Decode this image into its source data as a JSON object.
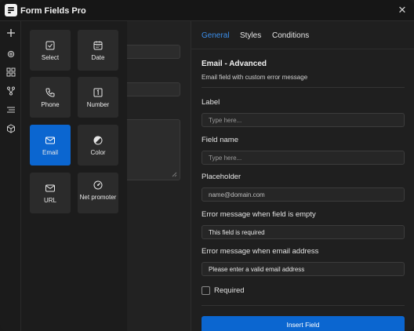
{
  "app": {
    "title": "Form Fields Pro"
  },
  "rail": {
    "icons": [
      "plus-icon",
      "gear-icon",
      "blocks-icon",
      "branch-icon",
      "align-icon",
      "cube-icon"
    ]
  },
  "picker": {
    "tiles": [
      {
        "label": "Select",
        "icon": "checkbox-icon"
      },
      {
        "label": "Date",
        "icon": "calendar-icon"
      },
      {
        "label": "Phone",
        "icon": "phone-icon"
      },
      {
        "label": "Number",
        "icon": "number-icon"
      },
      {
        "label": "Email",
        "icon": "mail-icon",
        "active": true
      },
      {
        "label": "Color",
        "icon": "color-icon"
      },
      {
        "label": "URL",
        "icon": "mail-icon"
      },
      {
        "label": "Net promoter",
        "icon": "gauge-icon"
      }
    ]
  },
  "panel": {
    "tabs": [
      {
        "label": "General",
        "active": true
      },
      {
        "label": "Styles"
      },
      {
        "label": "Conditions"
      }
    ],
    "section_title": "Email - Advanced",
    "section_desc": "Email field with custom error message",
    "fields": [
      {
        "label": "Label",
        "value": "",
        "placeholder": "Type here..."
      },
      {
        "label": "Field name",
        "value": "",
        "placeholder": "Type here..."
      },
      {
        "label": "Placeholder",
        "value": "name@domain.com",
        "placeholder": ""
      },
      {
        "label": "Error message when field is empty",
        "value": "This field is required",
        "placeholder": ""
      },
      {
        "label": "Error message when email address",
        "value": "Please enter a valid email address",
        "placeholder": ""
      }
    ],
    "required_label": "Required",
    "required_checked": false,
    "insert_label": "Insert Field"
  },
  "colors": {
    "accent": "#0b66d0",
    "tab_active": "#3b8eea"
  }
}
